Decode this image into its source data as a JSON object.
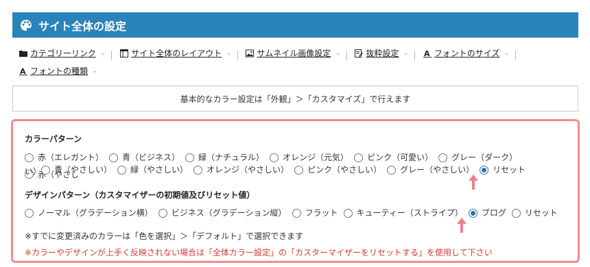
{
  "header": {
    "title": "サイト全体の設定",
    "icon": "palette-icon"
  },
  "links": [
    {
      "label": "カテゴリーリンク",
      "icon": "folder-icon"
    },
    {
      "label": "サイト全体のレイアウト",
      "icon": "layout-icon"
    },
    {
      "label": "サムネイル画像設定",
      "icon": "image-icon"
    },
    {
      "label": "抜粋設定",
      "icon": "edit-icon"
    },
    {
      "label": "フォントのサイズ",
      "icon": "font-icon"
    },
    {
      "label": "フォントの種類",
      "icon": "font-icon"
    }
  ],
  "notice": "基本的なカラー設定は「外観」＞「カスタマイズ」で行えます",
  "color_pattern": {
    "title": "カラーパターン",
    "row1": [
      "赤（エレガント）",
      "青（ビジネス）",
      "緑（ナチュラル）",
      "オレンジ（元気）",
      "ピンク（可愛い）",
      "グレー（ダーク）",
      "赤（やさし"
    ],
    "row2_prefix": "い）",
    "row2": [
      "青（やさしい）",
      "緑（やさしい）",
      "オレンジ（やさしい）",
      "ピンク（やさしい）",
      "グレー（やさしい）",
      "リセット"
    ],
    "selected": "リセット"
  },
  "design_pattern": {
    "title": "デザインパターン（カスタマイザーの初期値及びリセット値）",
    "options": [
      "ノーマル（グラデーション横）",
      "ビジネス（グラデーション縦）",
      "フラット",
      "キューティー（ストライプ）",
      "ブログ",
      "リセット"
    ],
    "selected": "ブログ"
  },
  "note": "※すでに変更済みのカラーは「色を選択」＞「デフォルト」で選択できます",
  "warning": "※カラーやデザインが上手く反映されない場合は「全体カラー設定」の「カスターマイザーをリセットする」を使用して下さい",
  "colors": {
    "header_bg": "#2a84bb",
    "panel_border": "#f28b8b",
    "warning": "#d43a2f",
    "radio_on": "#2a6fb8",
    "arrow": "#f07f8a"
  }
}
